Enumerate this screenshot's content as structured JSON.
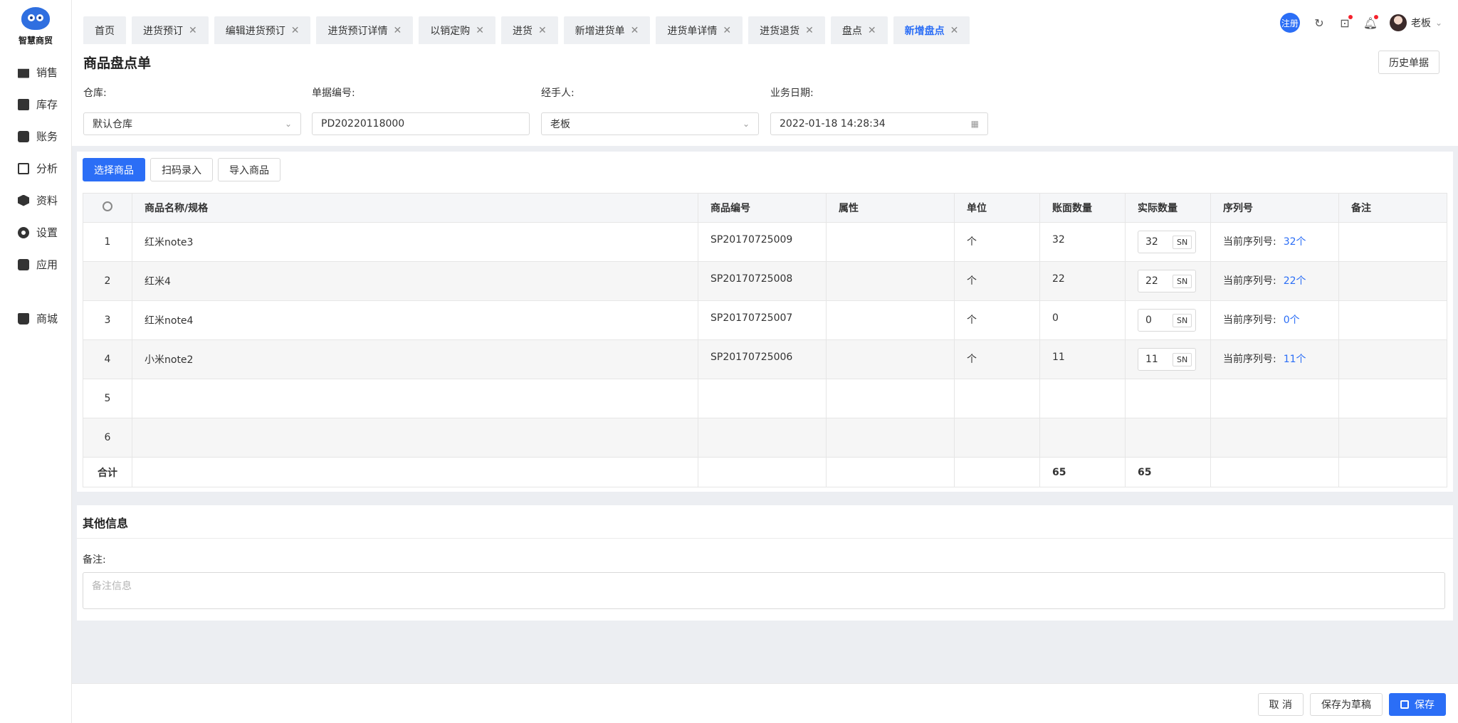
{
  "app": {
    "logo_text": "智慧商贸"
  },
  "sidebar": {
    "items": [
      {
        "label": "销售",
        "icon": "shop-icon"
      },
      {
        "label": "库存",
        "icon": "inventory-icon"
      },
      {
        "label": "账务",
        "icon": "wallet-icon"
      },
      {
        "label": "分析",
        "icon": "chart-icon"
      },
      {
        "label": "资料",
        "icon": "cube-icon"
      },
      {
        "label": "设置",
        "icon": "gear-icon"
      },
      {
        "label": "应用",
        "icon": "app-icon"
      }
    ],
    "mall": {
      "label": "商城",
      "icon": "bag-icon"
    }
  },
  "tabs": [
    {
      "label": "首页",
      "closable": false
    },
    {
      "label": "进货预订",
      "closable": true
    },
    {
      "label": "编辑进货预订",
      "closable": true
    },
    {
      "label": "进货预订详情",
      "closable": true
    },
    {
      "label": "以销定购",
      "closable": true
    },
    {
      "label": "进货",
      "closable": true
    },
    {
      "label": "新增进货单",
      "closable": true
    },
    {
      "label": "进货单详情",
      "closable": true
    },
    {
      "label": "进货退货",
      "closable": true
    },
    {
      "label": "盘点",
      "closable": true
    },
    {
      "label": "新增盘点",
      "closable": true,
      "active": true
    }
  ],
  "topbar": {
    "register_label": "注册",
    "user_name": "老板"
  },
  "page": {
    "title": "商品盘点单",
    "history_button": "历史单据"
  },
  "form": {
    "warehouse": {
      "label": "仓库:",
      "value": "默认仓库"
    },
    "doc_no": {
      "label": "单据编号:",
      "value": "PD20220118000"
    },
    "handler": {
      "label": "经手人:",
      "value": "老板"
    },
    "biz_date": {
      "label": "业务日期:",
      "value": "2022-01-18 14:28:34"
    }
  },
  "actions": {
    "select_goods": "选择商品",
    "scan_entry": "扫码录入",
    "import_goods": "导入商品"
  },
  "table": {
    "columns": [
      "商品名称/规格",
      "商品编号",
      "属性",
      "单位",
      "账面数量",
      "实际数量",
      "序列号",
      "备注"
    ],
    "serial_prefix": "当前序列号:",
    "sn_label": "SN",
    "rows": [
      {
        "idx": "1",
        "name": "红米note3",
        "code": "SP20170725009",
        "attr": "",
        "unit": "个",
        "book_qty": "32",
        "actual_qty": "32",
        "serial_count": "32个",
        "remark": ""
      },
      {
        "idx": "2",
        "name": "红米4",
        "code": "SP20170725008",
        "attr": "",
        "unit": "个",
        "book_qty": "22",
        "actual_qty": "22",
        "serial_count": "22个",
        "remark": ""
      },
      {
        "idx": "3",
        "name": "红米note4",
        "code": "SP20170725007",
        "attr": "",
        "unit": "个",
        "book_qty": "0",
        "actual_qty": "0",
        "serial_count": "0个",
        "remark": ""
      },
      {
        "idx": "4",
        "name": "小米note2",
        "code": "SP20170725006",
        "attr": "",
        "unit": "个",
        "book_qty": "11",
        "actual_qty": "11",
        "serial_count": "11个",
        "remark": ""
      },
      {
        "idx": "5"
      },
      {
        "idx": "6"
      }
    ],
    "total": {
      "label": "合计",
      "book_qty": "65",
      "actual_qty": "65"
    }
  },
  "other": {
    "title": "其他信息",
    "note_label": "备注:",
    "note_placeholder": "备注信息"
  },
  "footer": {
    "cancel": "取 消",
    "save_draft": "保存为草稿",
    "save": "保存"
  },
  "colors": {
    "primary": "#2b6ef6",
    "badge_red": "#f5222d"
  }
}
